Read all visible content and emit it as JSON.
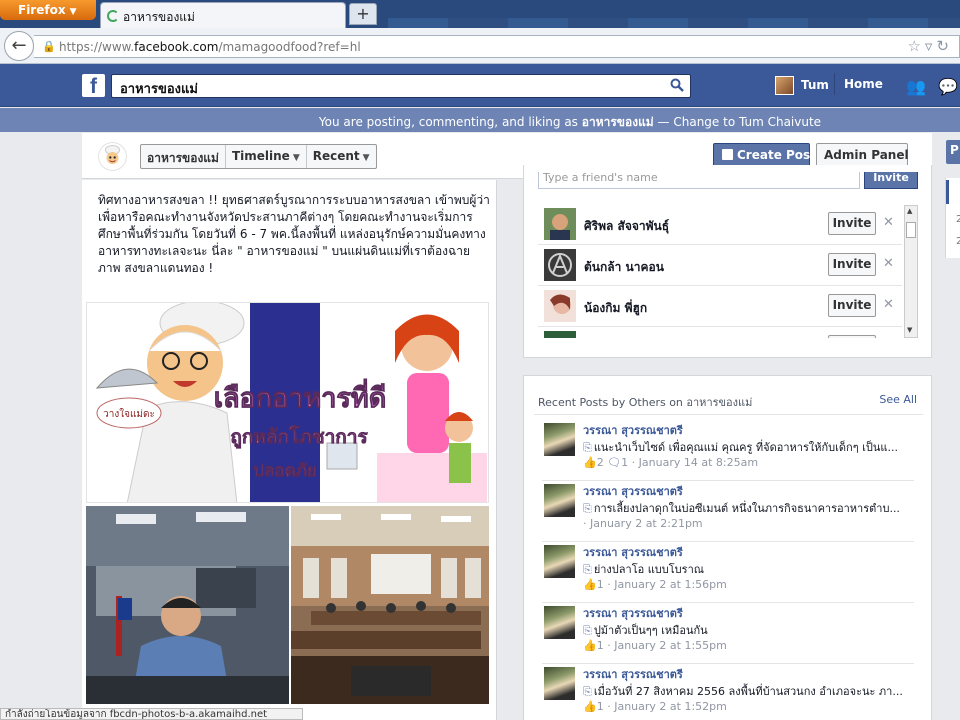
{
  "browser": {
    "menu_label": "Firefox",
    "tab_title": "อาหารของแม่",
    "url_prefix": "https://www.",
    "url_domain": "facebook.com",
    "url_path": "/mamagoodfood?ref=hl",
    "status_text": "กำลังถ่ายโอนข้อมูลจาก fbcdn-photos-b-a.akamaihd.net"
  },
  "fb": {
    "search_value": "อาหารของแม่",
    "user_name": "Tum",
    "home_label": "Home",
    "posting_as_prefix": "You are posting, commenting, and liking as",
    "posting_as_page": "อาหารของแม่",
    "posting_as_suffix": "— Change to Tum Chaivute"
  },
  "page_header": {
    "page_name_btn": "อาหารของแม่",
    "timeline_btn": "Timeline",
    "recent_btn": "Recent",
    "create_post": "Create Post",
    "admin_panel": "Admin Panel",
    "right_edge_letter": "P",
    "right_counts": [
      "2",
      "2"
    ]
  },
  "post": {
    "text": "ทิศทางอาหารสงขลา !! ยุทธศาสตร์บูรณาการระบบอาหารสงขลา เข้าพบผู้ว่าเพื่อหารือคณะทำงานจังหวัดประสานภาคีต่างๆ โดยคณะทำงานจะเริ่มการศึกษาพื้นที่ร่วมกัน โดยวันที่ 6 - 7 พค.นี้ลงพื้นที่ แหล่งอนุรักษ์ความมั่นคงทางอาหารทางทะเลจะนะ นี่ละ \" อาหารของแม่ \" บนแผ่นดินแม่ที่เราต้องฉายภาพ สงขลาแดนทอง !",
    "photo1_text": {
      "badge": "วางใจแม่ดะ",
      "line1": "เลือกอาหารที่ดี",
      "line2": "ถูกหลักโภชาการ",
      "line3": "ปลอดภัย"
    }
  },
  "invite": {
    "search_placeholder": "Type a friend's name",
    "search_button": "Invite",
    "friends": [
      {
        "name": "ศิริพล สัจจาพันธุ์",
        "button": "Invite"
      },
      {
        "name": "ต้นกล้า นาคอน",
        "button": "Invite"
      },
      {
        "name": "น้องกิม พี่ฮูก",
        "button": "Invite"
      }
    ]
  },
  "recent": {
    "header": "Recent Posts by Others on อาหารของแม่",
    "see_all": "See All",
    "posts": [
      {
        "author": "วรรณา สุวรรณชาตรี",
        "snippet": "แนะนำเว็บไซด์ เพื่อคุณแม่ คุณครู ที่จัดอาหารให้กับเด็กๆ เป็นแ...",
        "likes": "2",
        "comments": "1",
        "time": "January 14 at 8:25am"
      },
      {
        "author": "วรรณา สุวรรณชาตรี",
        "snippet": "การเลี้ยงปลาดุกในบ่อซีเมนต์ หนึ่งในภารกิจธนาคารอาหารตำบ...",
        "likes": "",
        "comments": "",
        "time": "January 2 at 2:21pm"
      },
      {
        "author": "วรรณา สุวรรณชาตรี",
        "snippet": "ย่างปลาโอ แบบโบราณ",
        "likes": "1",
        "comments": "",
        "time": "January 2 at 1:56pm"
      },
      {
        "author": "วรรณา สุวรรณชาตรี",
        "snippet": "ปูม้าตัวเป็นๆๆ เหมือนกัน",
        "likes": "1",
        "comments": "",
        "time": "January 2 at 1:55pm"
      },
      {
        "author": "วรรณา สุวรรณชาตรี",
        "snippet": "เมื่อวันที่ 27 สิงหาคม 2556 ลงพื้นที่บ้านสวนกง อำเภอจะนะ ภา...",
        "likes": "1",
        "comments": "",
        "time": "January 2 at 1:52pm"
      }
    ]
  },
  "colors": {
    "fb_blue": "#3b5998",
    "posting_bar": "#6d84b4",
    "link": "#3b5998"
  }
}
